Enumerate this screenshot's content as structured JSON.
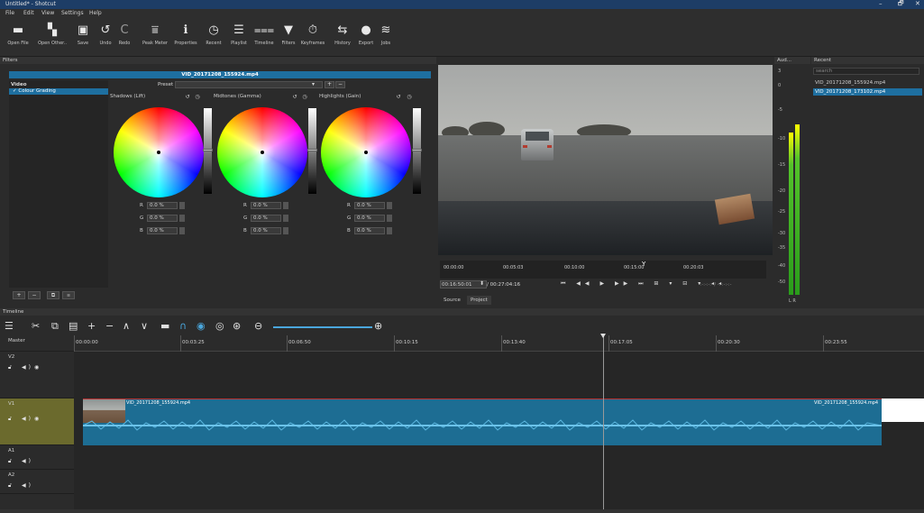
{
  "window": {
    "title": "Untitled* - Shotcut",
    "controls": [
      "–",
      "🗗",
      "✕"
    ]
  },
  "menu": [
    "File",
    "Edit",
    "View",
    "Settings",
    "Help"
  ],
  "toolbar": [
    {
      "label": "Open File",
      "icon": "folder-icon"
    },
    {
      "label": "Open Other..",
      "icon": "open-other-icon"
    },
    {
      "label": "Save",
      "icon": "save-icon"
    },
    {
      "label": "Undo",
      "icon": "undo-icon"
    },
    {
      "label": "Redo",
      "icon": "redo-icon"
    },
    {
      "label": "Peak Meter",
      "icon": "peak-meter-icon"
    },
    {
      "label": "Properties",
      "icon": "info-icon"
    },
    {
      "label": "Recent",
      "icon": "clock-icon"
    },
    {
      "label": "Playlist",
      "icon": "list-icon"
    },
    {
      "label": "Timeline",
      "icon": "timeline-icon"
    },
    {
      "label": "Filters",
      "icon": "filter-icon"
    },
    {
      "label": "Keyframes",
      "icon": "stopwatch-icon"
    },
    {
      "label": "History",
      "icon": "history-icon"
    },
    {
      "label": "Export",
      "icon": "export-icon"
    },
    {
      "label": "Jobs",
      "icon": "jobs-icon"
    }
  ],
  "filters": {
    "panel_title": "Filters",
    "clip_name": "VID_20171208_155924.mp4",
    "section": "Video",
    "selected_filter": "Colour Grading",
    "preset_label": "Preset",
    "wheels": [
      {
        "title": "Shadows (Lift)",
        "r": "0.0 %",
        "g": "0.0 %",
        "b": "0.0 %"
      },
      {
        "title": "Midtones (Gamma)",
        "r": "0.0 %",
        "g": "0.0 %",
        "b": "0.0 %"
      },
      {
        "title": "Highlights (Gain)",
        "r": "0.0 %",
        "g": "0.0 %",
        "b": "0.0 %"
      }
    ],
    "rgb_labels": [
      "R",
      "G",
      "B"
    ]
  },
  "viewer": {
    "ruler_labels": [
      "00:00:00",
      "00:05:03",
      "00:10:00",
      "00:15:00",
      "00:20:03"
    ],
    "timecode_current": "00:16:50:01",
    "timecode_total": "/ 00:27:04:16",
    "transport": "⏮ ◀◀ ▶ ▶▶ ⏭ ⊞ ▾ ⊟ ▾ ◂◂",
    "zoom_marks": "-:-:-:-:-  /  -:-:-:-:-",
    "tabs": [
      "Source",
      "Project"
    ],
    "active_tab": "Project"
  },
  "audio": {
    "title": "Aud...",
    "scale": [
      "3",
      "0",
      "-5",
      "-10",
      "-15",
      "-20",
      "-25",
      "-30",
      "-35",
      "-40",
      "-50"
    ],
    "channels": "L R"
  },
  "recent": {
    "title": "Recent",
    "search_placeholder": "search",
    "items": [
      "VID_20171208_155924.mp4",
      "VID_20171208_173102.mp4"
    ]
  },
  "timeline": {
    "title": "Timeline",
    "ruler": [
      "00:00:00",
      "00:03:25",
      "00:06:50",
      "00:10:15",
      "00:13:40",
      "00:17:05",
      "00:20:30",
      "00:23:55"
    ],
    "tracks": [
      "Master",
      "V2",
      "V1",
      "A1",
      "A2"
    ],
    "clip_label_1": "VID_20171208_155924.mp4",
    "clip_label_2": "VID_20171208_155924.mp4"
  },
  "colors": {
    "accent": "#1e6fa0",
    "clip": "#1d6d93",
    "titlebar": "#1d3d66"
  }
}
